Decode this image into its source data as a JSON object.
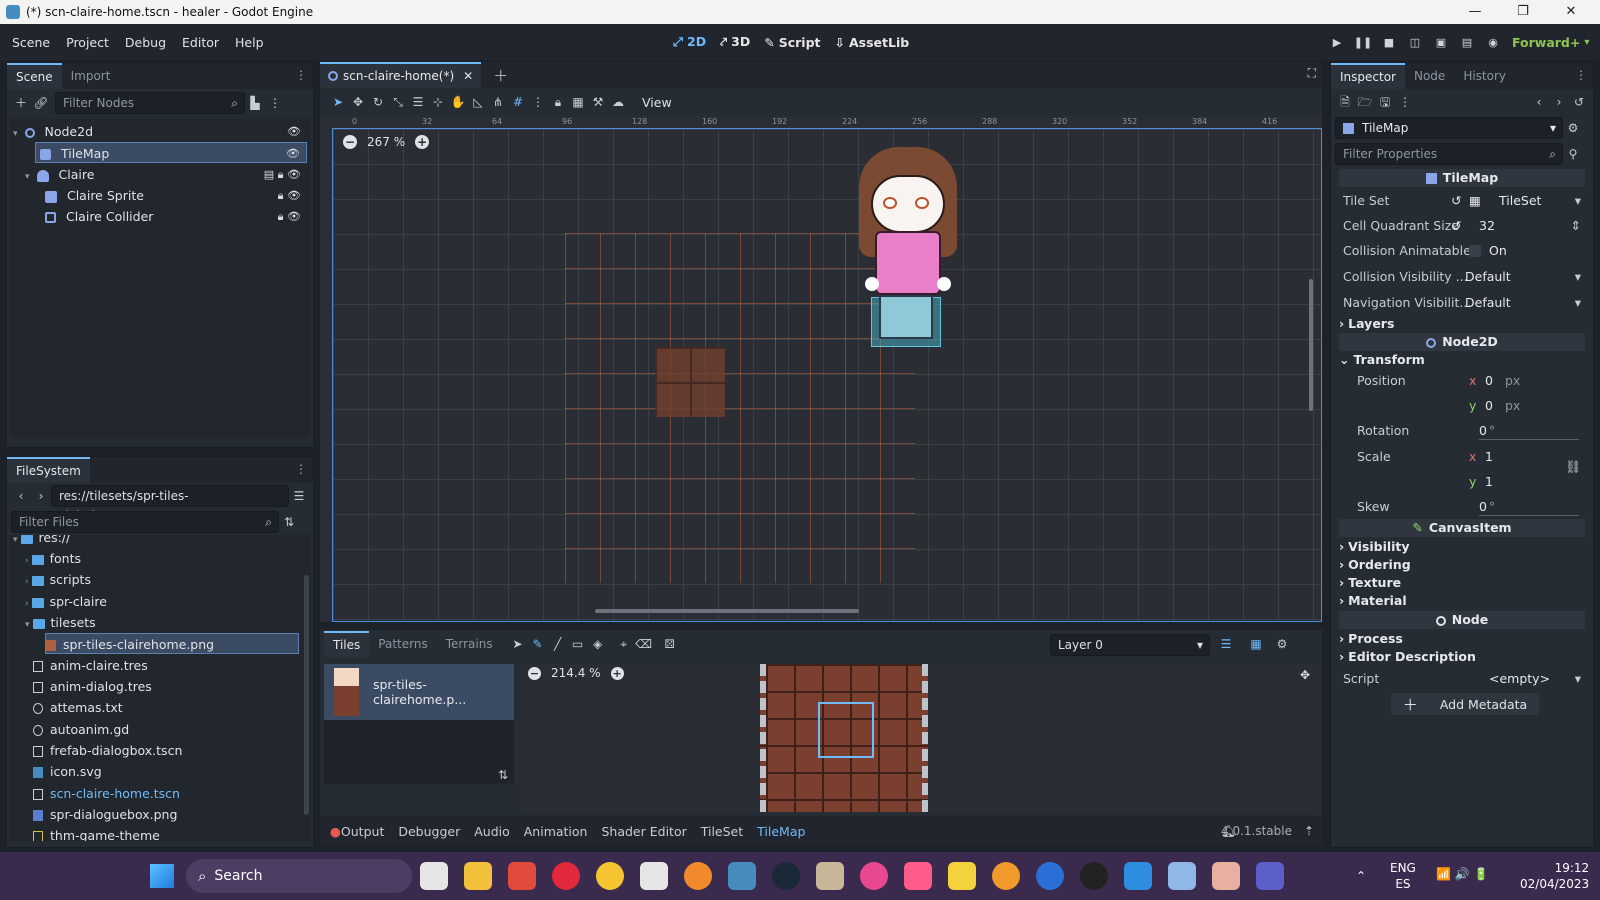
{
  "window": {
    "title": "(*) scn-claire-home.tscn - healer - Godot Engine"
  },
  "menu": {
    "items": [
      "Scene",
      "Project",
      "Debug",
      "Editor",
      "Help"
    ],
    "workspaces": [
      {
        "icon": "2d-icon",
        "label": "2D"
      },
      {
        "icon": "3d-icon",
        "label": "3D"
      },
      {
        "icon": "script-icon",
        "label": "Script"
      },
      {
        "icon": "assetlib-icon",
        "label": "AssetLib"
      }
    ],
    "renderer": "Forward+"
  },
  "scene_dock": {
    "tabs": [
      "Scene",
      "Import"
    ],
    "filter_placeholder": "Filter Nodes",
    "nodes": [
      {
        "label": "Node2d"
      },
      {
        "label": "TileMap"
      },
      {
        "label": "Claire"
      },
      {
        "label": "Claire Sprite"
      },
      {
        "label": "Claire Collider"
      }
    ]
  },
  "filesystem": {
    "tab": "FileSystem",
    "path": "res://tilesets/spr-tiles-clairehome.png",
    "filter_placeholder": "Filter Files",
    "items": [
      {
        "label": "res://"
      },
      {
        "label": "fonts"
      },
      {
        "label": "scripts"
      },
      {
        "label": "spr-claire"
      },
      {
        "label": "tilesets"
      },
      {
        "label": "spr-tiles-clairehome.png"
      },
      {
        "label": "anim-claire.tres"
      },
      {
        "label": "anim-dialog.tres"
      },
      {
        "label": "attemas.txt"
      },
      {
        "label": "autoanim.gd"
      },
      {
        "label": "frefab-dialogbox.tscn"
      },
      {
        "label": "icon.svg"
      },
      {
        "label": "scn-claire-home.tscn"
      },
      {
        "label": "spr-dialoguebox.png"
      },
      {
        "label": "thm-game-theme"
      }
    ]
  },
  "editor": {
    "tab": "scn-claire-home(*)",
    "zoom": "267 %",
    "view_label": "View",
    "ruler_marks": [
      "0",
      "32",
      "64",
      "96",
      "128",
      "160",
      "192",
      "224",
      "256",
      "288",
      "320",
      "352",
      "384",
      "416"
    ]
  },
  "tilemap_panel": {
    "tabs": [
      "Tiles",
      "Patterns",
      "Terrains"
    ],
    "source_name": "spr-tiles-clairehome.p...",
    "zoom": "214.4 %",
    "layer": "Layer 0"
  },
  "bottom_bar": {
    "tabs": [
      "Output",
      "Debugger",
      "Audio",
      "Animation",
      "Shader Editor",
      "TileSet",
      "TileMap"
    ],
    "version": "4.0.1.stable"
  },
  "inspector": {
    "tabs": [
      "Inspector",
      "Node",
      "History"
    ],
    "object": "TileMap",
    "filter_placeholder": "Filter Properties",
    "class_header": "TileMap",
    "tile_set": {
      "label": "Tile Set",
      "value": "TileSet"
    },
    "cell_quadrant": {
      "label": "Cell Quadrant Size",
      "value": "32"
    },
    "collision_animatable": {
      "label": "Collision Animatable",
      "value": "On"
    },
    "collision_visibility": {
      "label": "Collision Visibility ...",
      "value": "Default"
    },
    "navigation_visibility": {
      "label": "Navigation Visibilit...",
      "value": "Default"
    },
    "layers": "Layers",
    "node2d_header": "Node2D",
    "transform": "Transform",
    "position": {
      "label": "Position",
      "x": "0",
      "y": "0",
      "unit": "px"
    },
    "rotation": {
      "label": "Rotation",
      "value": "0",
      "unit": "°"
    },
    "scale": {
      "label": "Scale",
      "x": "1",
      "y": "1"
    },
    "skew": {
      "label": "Skew",
      "value": "0",
      "unit": "°"
    },
    "canvasitem_header": "CanvasItem",
    "canvas_groups": [
      "Visibility",
      "Ordering",
      "Texture",
      "Material"
    ],
    "node_header": "Node",
    "node_groups": [
      "Process",
      "Editor Description"
    ],
    "script": {
      "label": "Script",
      "value": "<empty>"
    },
    "add_metadata": "Add Metadata"
  },
  "taskbar": {
    "search": "Search",
    "lang_1": "ENG",
    "lang_2": "ES",
    "time": "19:12",
    "date": "02/04/2023"
  }
}
